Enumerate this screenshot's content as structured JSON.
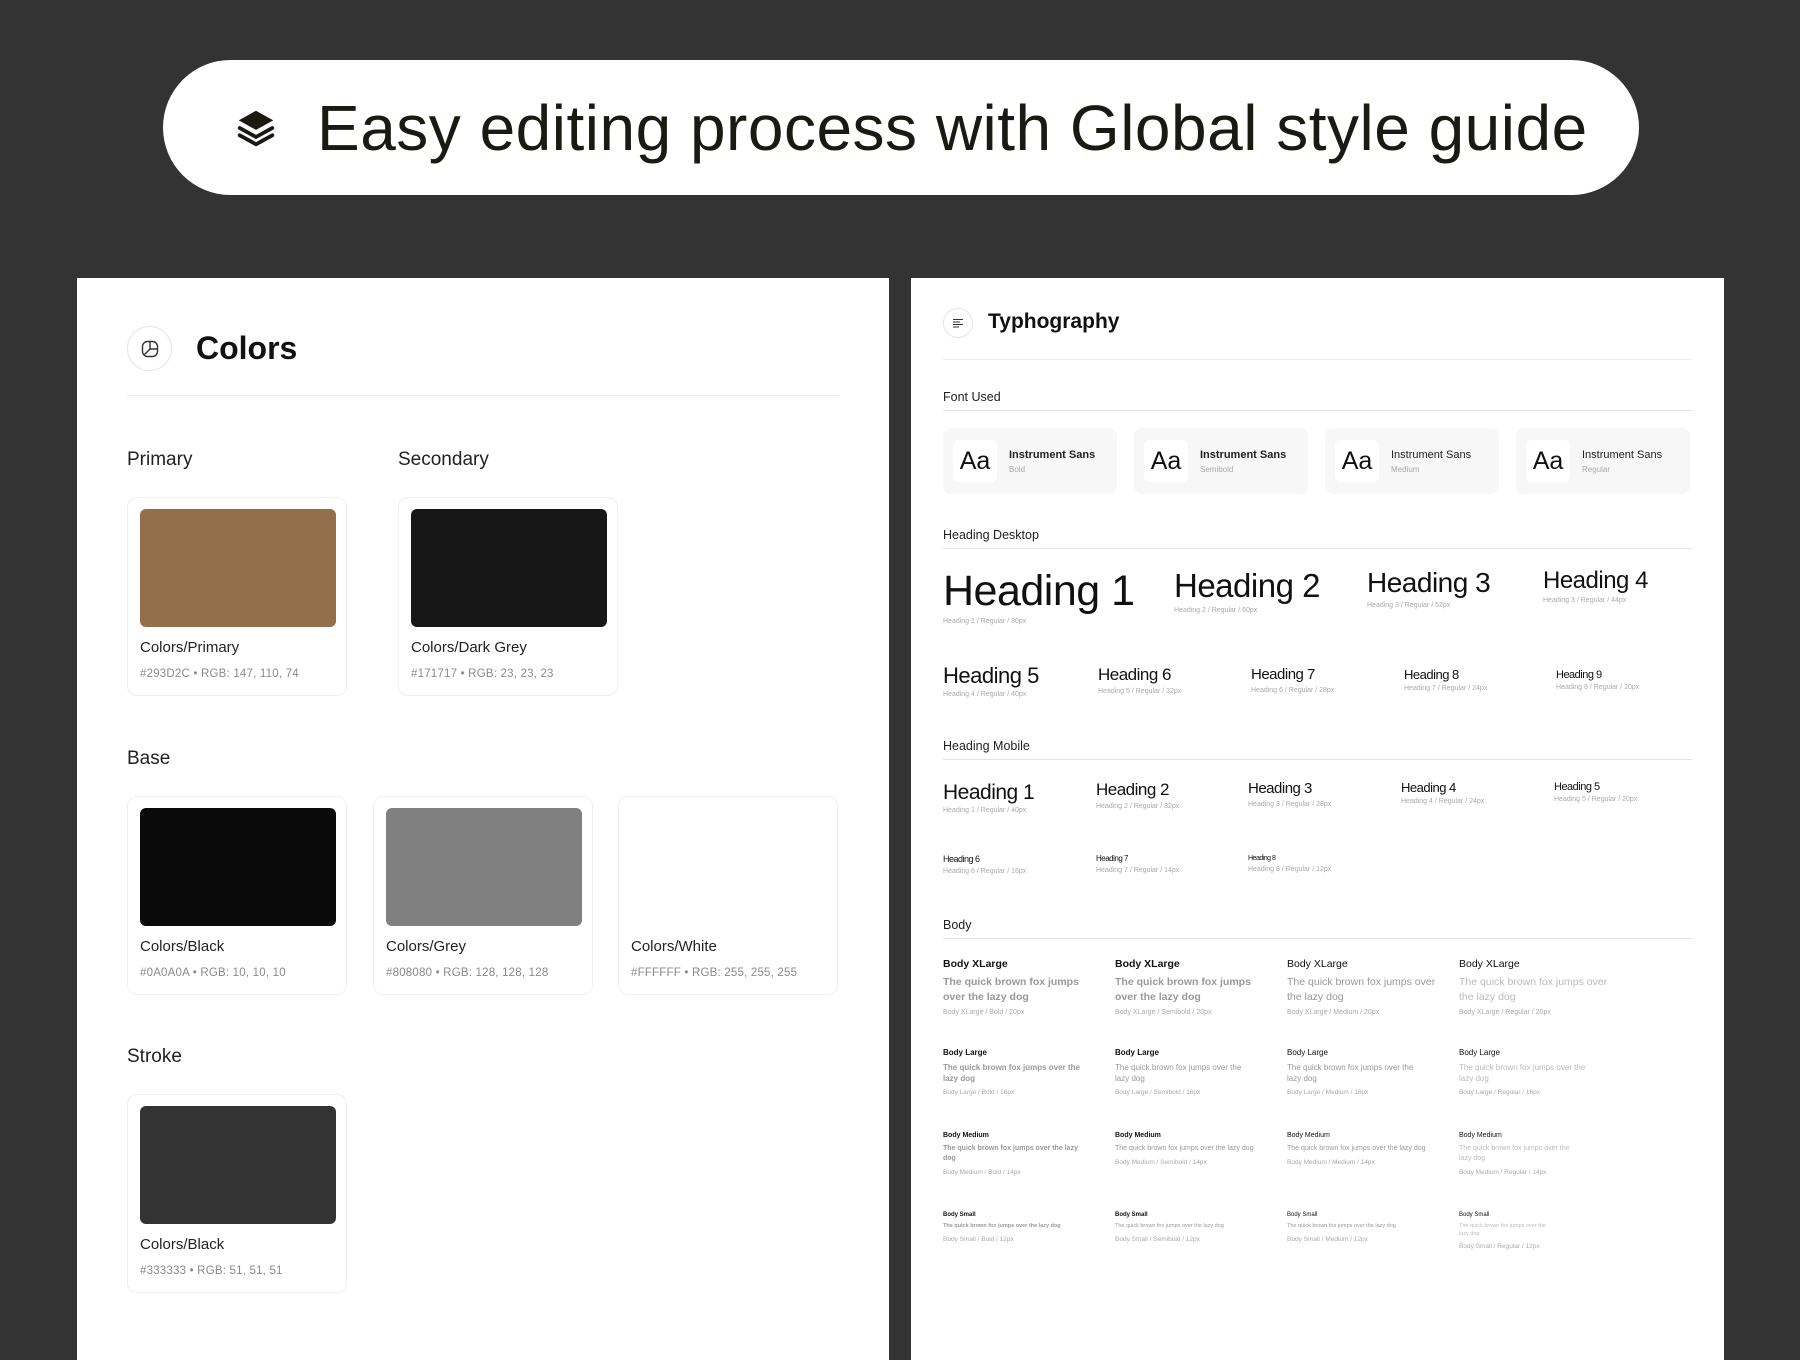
{
  "banner": {
    "icon": "layers-icon",
    "title": "Easy editing process with Global style guide"
  },
  "colors": {
    "icon": "palette-icon",
    "title": "Colors",
    "groups": {
      "primary": "Primary",
      "secondary": "Secondary",
      "base": "Base",
      "stroke": "Stroke"
    },
    "swatches": [
      {
        "name": "Colors/Primary",
        "meta": "#293D2C  •  RGB: 147, 110, 74",
        "color": "#936E4A"
      },
      {
        "name": "Colors/Dark Grey",
        "meta": "#171717  •  RGB: 23, 23, 23",
        "color": "#171717"
      },
      {
        "name": "Colors/Black",
        "meta": "#0A0A0A  •  RGB: 10, 10, 10",
        "color": "#0A0A0A"
      },
      {
        "name": "Colors/Grey",
        "meta": "#808080  •  RGB: 128, 128, 128",
        "color": "#808080"
      },
      {
        "name": "Colors/White",
        "meta": "#FFFFFF  •  RGB: 255, 255, 255",
        "color": "#FFFFFF"
      },
      {
        "name": "Colors/Black",
        "meta": "#333333  •  RGB: 51, 51, 51",
        "color": "#333333"
      }
    ]
  },
  "typography": {
    "icon": "text-align-icon",
    "title": "Typhography",
    "font_used_label": "Font Used",
    "fonts": [
      {
        "aa": "Aa",
        "name": "Instrument Sans",
        "weight": "Bold"
      },
      {
        "aa": "Aa",
        "name": "Instrument Sans",
        "weight": "Semibold"
      },
      {
        "aa": "Aa",
        "name": "Instrument Sans",
        "weight": "Medium"
      },
      {
        "aa": "Aa",
        "name": "Instrument Sans",
        "weight": "Regular"
      }
    ],
    "heading_desktop_label": "Heading Desktop",
    "desktop": [
      {
        "text": "Heading 1",
        "meta": "Heading 1 / Regular / 80px"
      },
      {
        "text": "Heading 2",
        "meta": "Heading 2 / Regular / 60px"
      },
      {
        "text": "Heading 3",
        "meta": "Heading 3 / Regular / 52px"
      },
      {
        "text": "Heading 4",
        "meta": "Heading 3 / Regular / 44px"
      },
      {
        "text": "Heading 5",
        "meta": "Heading 4 / Regular / 40px"
      },
      {
        "text": "Heading 6",
        "meta": "Heading 5 / Regular / 32px"
      },
      {
        "text": "Heading 7",
        "meta": "Heading 6 / Regular / 28px"
      },
      {
        "text": "Heading 8",
        "meta": "Heading 7 / Regular / 24px"
      },
      {
        "text": "Heading 9",
        "meta": "Heading 8 / Regular / 20px"
      }
    ],
    "heading_mobile_label": "Heading Mobile",
    "mobile": [
      {
        "text": "Heading 1",
        "meta": "Heading 1 / Regular / 40px"
      },
      {
        "text": "Heading 2",
        "meta": "Heading 2 / Regular / 32px"
      },
      {
        "text": "Heading 3",
        "meta": "Heading 3 / Regular / 28px"
      },
      {
        "text": "Heading 4",
        "meta": "Heading 4 / Regular / 24px"
      },
      {
        "text": "Heading 5",
        "meta": "Heading 5 / Regular / 20px"
      },
      {
        "text": "Heading 6",
        "meta": "Heading 6 / Regular / 16px"
      },
      {
        "text": "Heading 7",
        "meta": "Heading 7 / Regular / 14px"
      },
      {
        "text": "Heading 8",
        "meta": "Heading 8 / Regular / 12px"
      }
    ],
    "body_label": "Body",
    "body": [
      {
        "title": "Body XLarge",
        "text": "The quick brown fox jumps over the lazy dog",
        "meta": "Body XLarge / Bold / 20px"
      },
      {
        "title": "Body XLarge",
        "text": "The quick brown fox jumps over the lazy dog",
        "meta": "Body XLarge / Semibold / 20px"
      },
      {
        "title": "Body XLarge",
        "text": "The quick brown fox jumps over the lazy dog",
        "meta": "Body XLarge / Medium / 20px"
      },
      {
        "title": "Body XLarge",
        "text": "The quick brown fox jumps over the lazy dog",
        "meta": "Body XLarge / Regular / 20px"
      },
      {
        "title": "Body Large",
        "text": "The quick brown fox jumps over the lazy dog",
        "meta": "Body Large / Bold / 16px"
      },
      {
        "title": "Body Large",
        "text": "The quick brown fox jumps over the lazy dog",
        "meta": "Body Large / Semibold / 16px"
      },
      {
        "title": "Body Large",
        "text": "The quick brown fox jumps over the lazy dog",
        "meta": "Body Large / Medium / 16px"
      },
      {
        "title": "Body Large",
        "text": "The quick brown fox jumps over the lazy dog",
        "meta": "Body Large / Regular / 16px"
      },
      {
        "title": "Body Medium",
        "text": "The quick brown fox jumps over the lazy dog",
        "meta": "Body Medium / Bold / 14px"
      },
      {
        "title": "Body Medium",
        "text": "The quick brown fox jumps over the lazy dog",
        "meta": "Body Medium / Semibold / 14px"
      },
      {
        "title": "Body Medium",
        "text": "The quick brown fox jumps over the lazy dog",
        "meta": "Body Medium / Medium / 14px"
      },
      {
        "title": "Body Medium",
        "text": "The quick brown fox jumps over the lazy dog",
        "meta": "Body Medium / Regular / 14px"
      },
      {
        "title": "Body Small",
        "text": "The quick brown fox jumps over the lazy dog",
        "meta": "Body Small / Bold / 12px"
      },
      {
        "title": "Body Small",
        "text": "The quick brown fox jumps over the lazy dog",
        "meta": "Body Small / Semibold / 12px"
      },
      {
        "title": "Body Small",
        "text": "The quick brown fox jumps over the lazy dog",
        "meta": "Body Small / Medium / 12px"
      },
      {
        "title": "Body Small",
        "text": "The quick brown fox jumps over the lazy dog",
        "meta": "Body Small / Regular / 12px"
      }
    ]
  }
}
